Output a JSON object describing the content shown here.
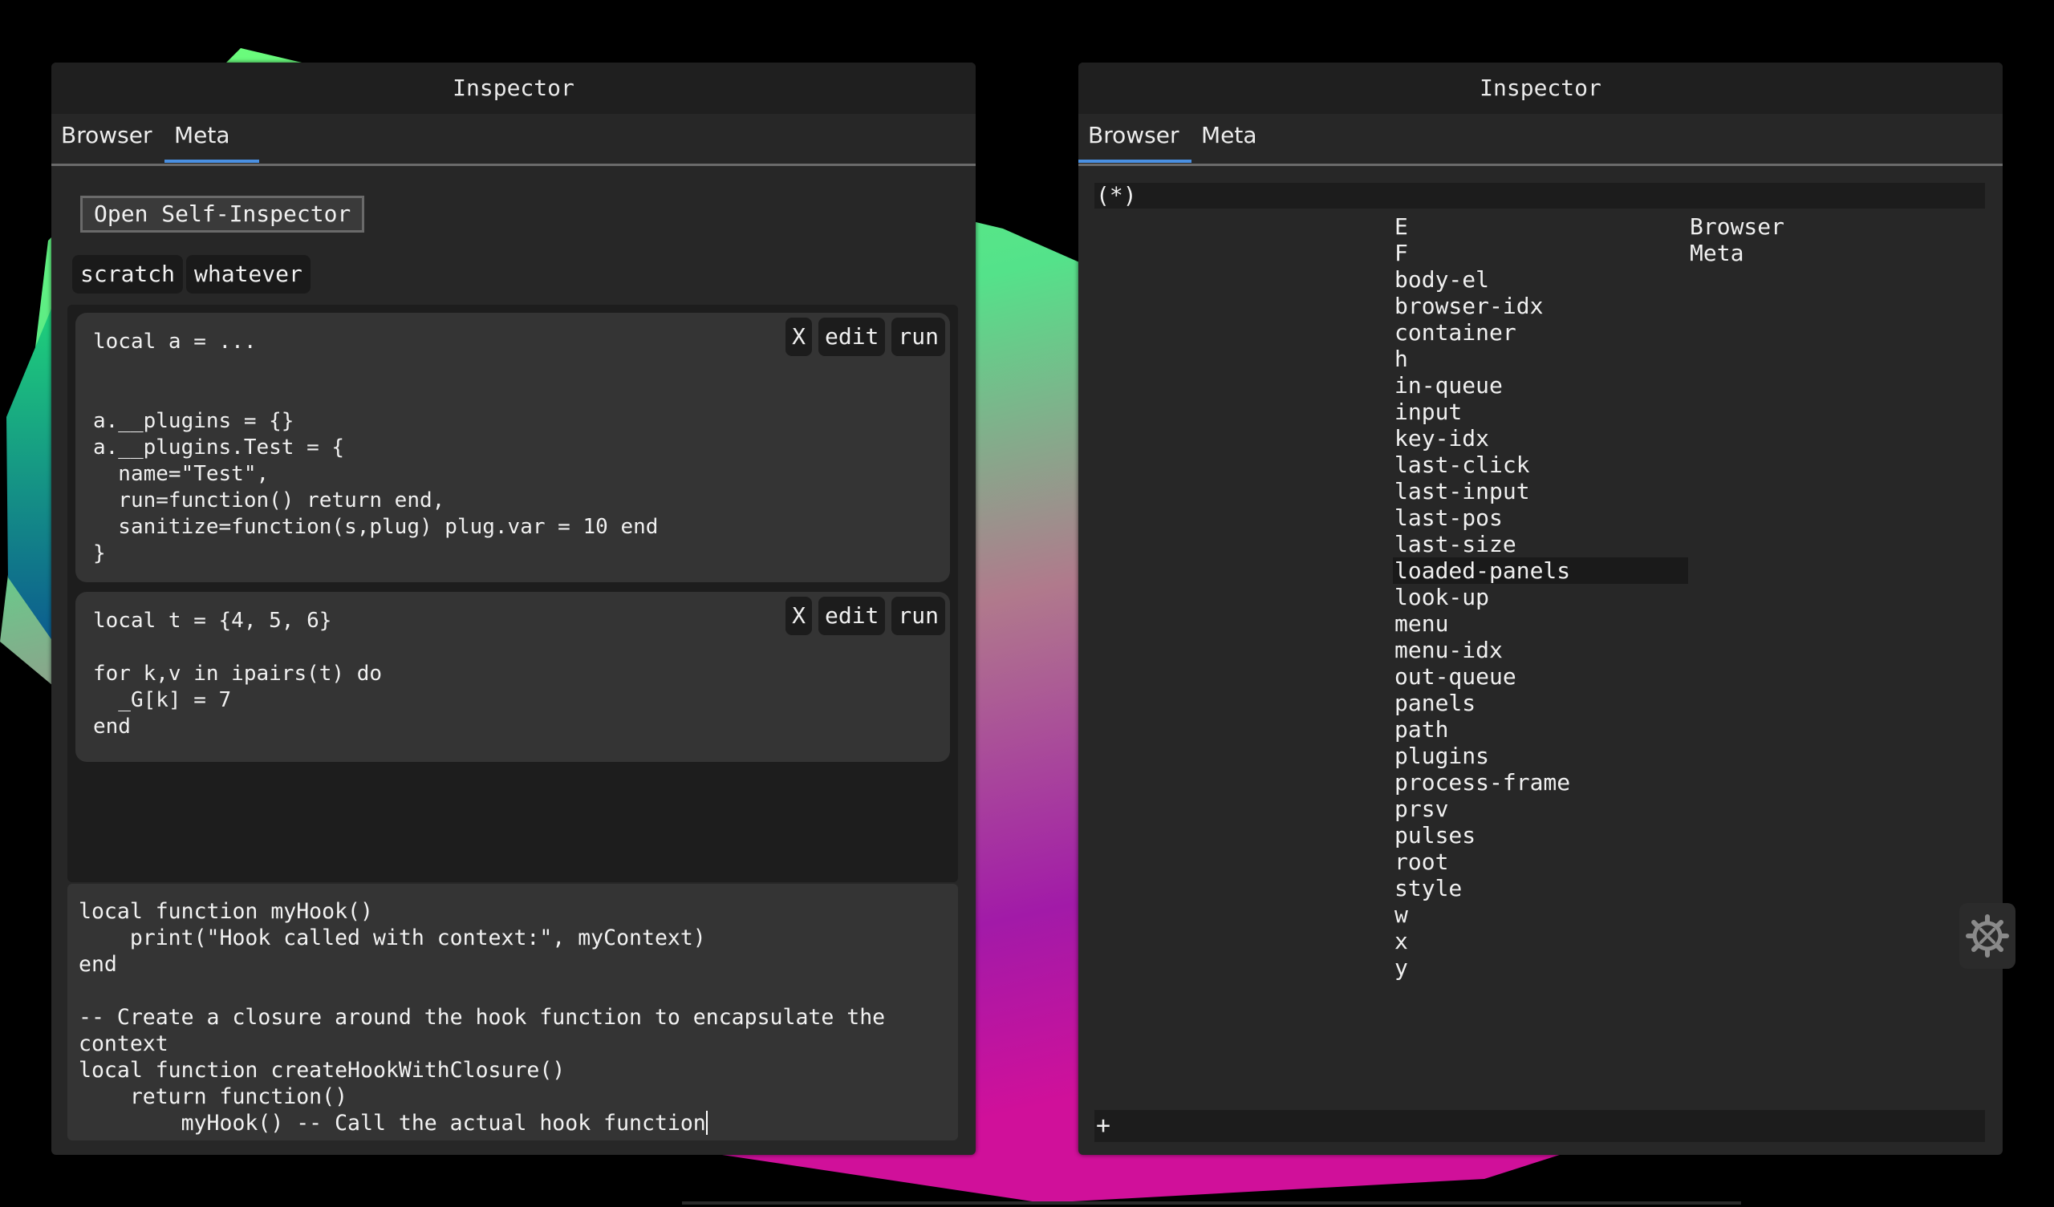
{
  "left_panel": {
    "title": "Inspector",
    "tabs": [
      {
        "label": "Browser"
      },
      {
        "label": "Meta"
      }
    ],
    "active_tab": "Meta",
    "open_self_inspector_label": "Open Self-Inspector",
    "scratch_tabs": [
      {
        "label": "scratch"
      },
      {
        "label": "whatever"
      }
    ],
    "cell_buttons": {
      "close": "X",
      "edit": "edit",
      "run": "run"
    },
    "cells": [
      {
        "code": "local a = ...\n\n\na.__plugins = {}\na.__plugins.Test = {\n  name=\"Test\",\n  run=function() return end,\n  sanitize=function(s,plug) plug.var = 10 end\n}"
      },
      {
        "code": "local t = {4, 5, 6}\n\nfor k,v in ipairs(t) do\n  _G[k] = 7\nend"
      }
    ],
    "editor_code": "local function myHook()\n    print(\"Hook called with context:\", myContext)\nend\n\n-- Create a closure around the hook function to encapsulate the\ncontext\nlocal function createHookWithClosure()\n    return function()\n        myHook() -- Call the actual hook function"
  },
  "right_panel": {
    "title": "Inspector",
    "tabs": [
      {
        "label": "Browser"
      },
      {
        "label": "Meta"
      }
    ],
    "active_tab": "Browser",
    "path": "(*)",
    "keys": [
      "E",
      "F",
      "body-el",
      "browser-idx",
      "container",
      "h",
      "in-queue",
      "input",
      "key-idx",
      "last-click",
      "last-input",
      "last-pos",
      "last-size",
      "loaded-panels",
      "look-up",
      "menu",
      "menu-idx",
      "out-queue",
      "panels",
      "path",
      "plugins",
      "process-frame",
      "prsv",
      "pulses",
      "root",
      "style",
      "w",
      "x",
      "y"
    ],
    "selected_key": "loaded-panels",
    "values": [
      "Browser",
      "Meta"
    ],
    "add_label": "+"
  },
  "icons": {
    "settings": "gear-icon"
  },
  "colors": {
    "tab_accent": "#4a90e2",
    "panel_bg": "#272727",
    "title_bg": "#1f1f1f"
  }
}
